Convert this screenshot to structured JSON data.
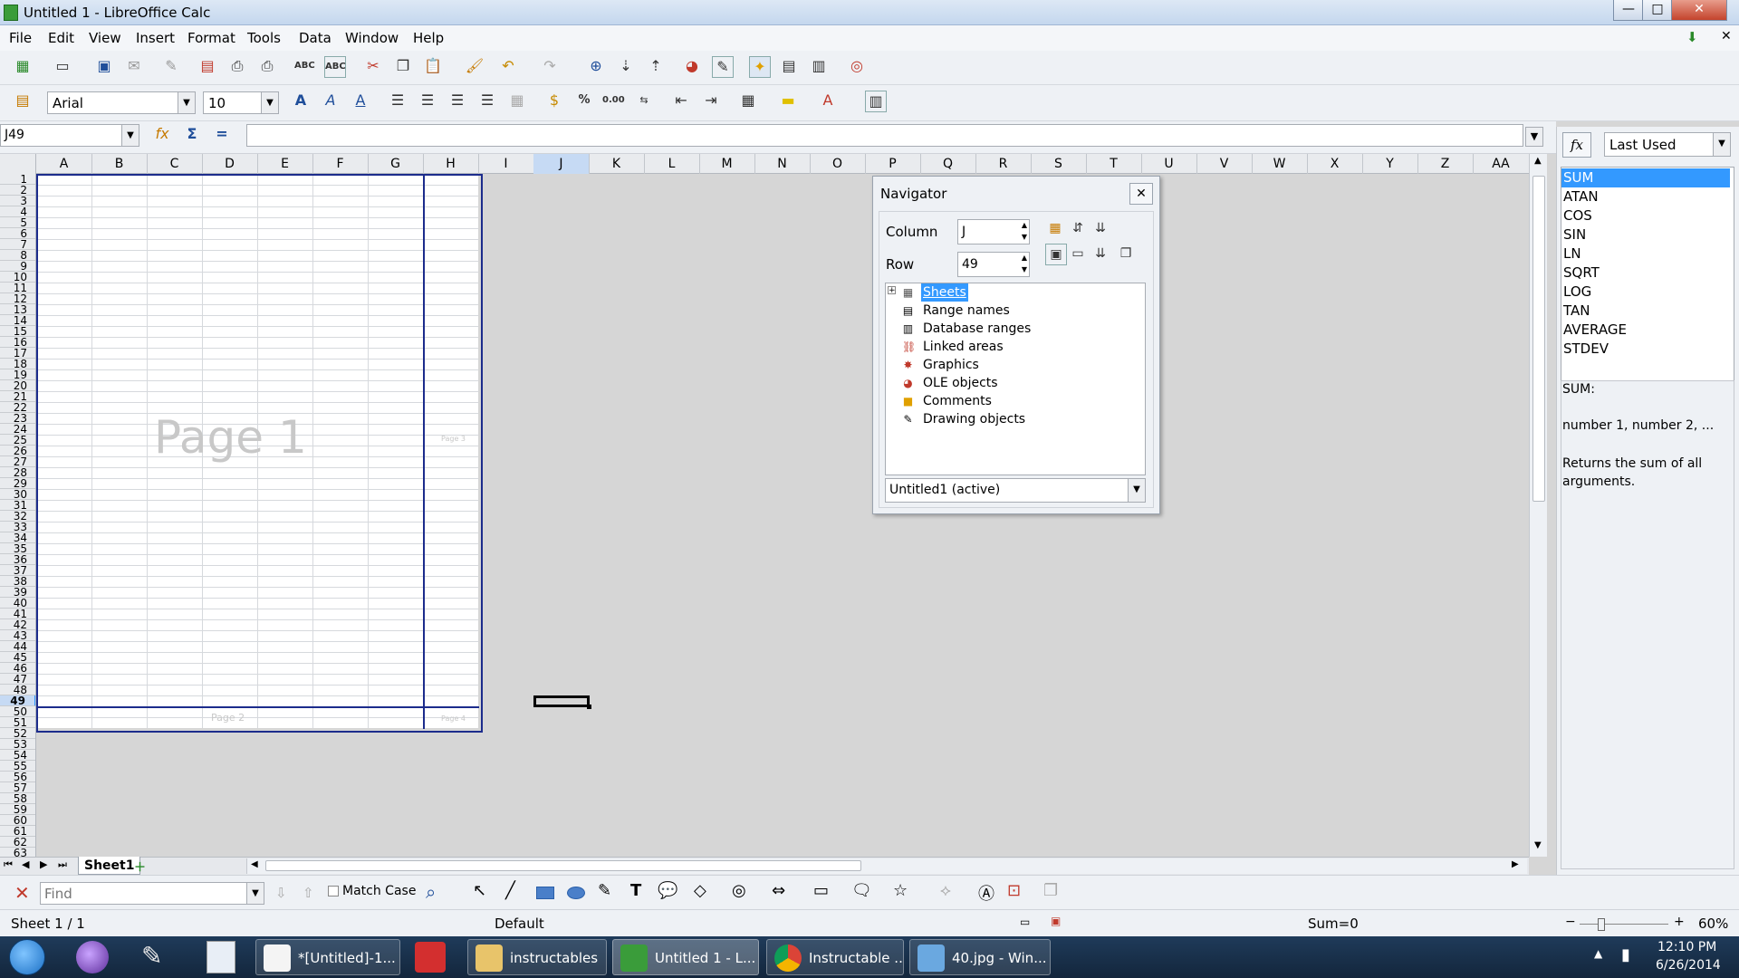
{
  "window": {
    "title": "Untitled 1 - LibreOffice Calc",
    "min": "—",
    "max": "□",
    "close": "✕",
    "doc_close": "✕"
  },
  "menu": [
    "File",
    "Edit",
    "View",
    "Insert",
    "Format",
    "Tools",
    "Data",
    "Window",
    "Help"
  ],
  "format_bar": {
    "font_name": "Arial",
    "font_size": "10",
    "percent": "%",
    "decimal": "0.00"
  },
  "formula_bar": {
    "name_box": "J49",
    "formula": ""
  },
  "columns": [
    "A",
    "B",
    "C",
    "D",
    "E",
    "F",
    "G",
    "H",
    "I",
    "J",
    "K",
    "L",
    "M",
    "N",
    "O",
    "P",
    "Q",
    "R",
    "S",
    "T",
    "U",
    "V",
    "W",
    "X",
    "Y",
    "Z",
    "AA"
  ],
  "selected_cell": {
    "column": "J",
    "row": "49"
  },
  "page_labels": {
    "page1": "Page 1",
    "page2": "Page 2",
    "page3": "Page 3",
    "page4": "Page 4"
  },
  "navigator": {
    "title": "Navigator",
    "column_label": "Column",
    "column_value": "J",
    "row_label": "Row",
    "row_value": "49",
    "items": [
      "Sheets",
      "Range names",
      "Database ranges",
      "Linked areas",
      "Graphics",
      "OLE objects",
      "Comments",
      "Drawing objects"
    ],
    "document": "Untitled1 (active)"
  },
  "sidebar": {
    "category": "Last Used",
    "fx": "fx",
    "functions": [
      "SUM",
      "ATAN",
      "COS",
      "SIN",
      "LN",
      "SQRT",
      "LOG",
      "TAN",
      "AVERAGE",
      "STDEV"
    ],
    "selected": "SUM",
    "desc_name": "SUM:",
    "desc_args": "number 1, number 2, ...",
    "desc_text": "Returns the sum of all arguments."
  },
  "sheet_tab": "Sheet1",
  "find_bar": {
    "placeholder": "Find",
    "match_case": "Match Case"
  },
  "status": {
    "sheet": "Sheet 1 / 1",
    "style": "Default",
    "sum": "Sum=0",
    "zoom": "60%"
  },
  "taskbar": {
    "tasks": [
      "*[Untitled]-1...",
      "instructables",
      "Untitled 1 - L...",
      "Instructable ...",
      "40.jpg - Win..."
    ],
    "time": "12:10 PM",
    "date": "6/26/2014"
  },
  "colors": {
    "accent": "#3399ff",
    "page_border": "#1c2c8c"
  }
}
